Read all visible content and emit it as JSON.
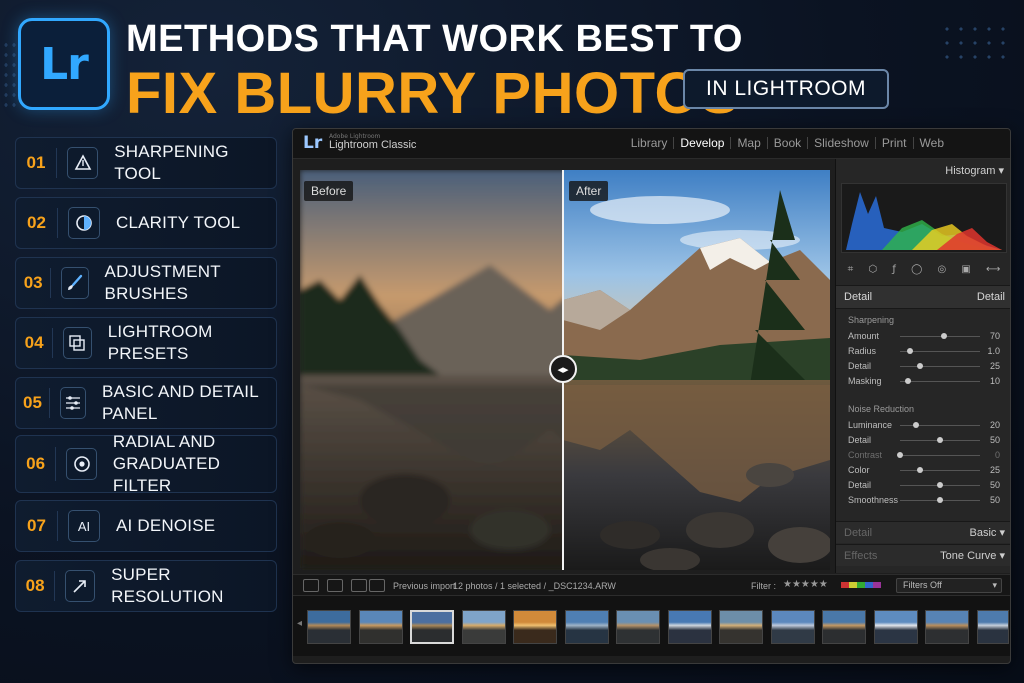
{
  "header": {
    "logo_text": "Lr",
    "title_line1": "METHODS THAT WORK BEST TO",
    "title_line2": "FIX BLURRY PHOTOS",
    "subtitle": "IN LIGHTROOM",
    "accent_color": "#f7a21b",
    "brand_color": "#31a8ff"
  },
  "methods": [
    {
      "num": "01",
      "label": "SHARPENING TOOL",
      "icon": "sharpen-triangle-icon"
    },
    {
      "num": "02",
      "label": "CLARITY TOOL",
      "icon": "half-circle-icon"
    },
    {
      "num": "03",
      "label": "ADJUSTMENT BRUSHES",
      "icon": "brush-icon"
    },
    {
      "num": "04",
      "label": "LIGHTROOM PRESETS",
      "icon": "presets-icon"
    },
    {
      "num": "05",
      "label": "BASIC AND DETAIL PANEL",
      "icon": "sliders-icon"
    },
    {
      "num": "06",
      "label": "RADIAL AND GRADUATED FILTER",
      "label_line1": "RADIAL AND",
      "label_line2": "GRADUATED FILTER",
      "icon": "radial-filter-icon"
    },
    {
      "num": "07",
      "label": "AI DENOISE",
      "icon": "ai-icon"
    },
    {
      "num": "08",
      "label": "SUPER RESOLUTION",
      "icon": "expand-arrow-icon"
    }
  ],
  "lightroom": {
    "logo": "Lr",
    "adobe": "Adobe Lightroom",
    "app_name": "Lightroom Classic",
    "modules": [
      "Library",
      "Develop",
      "Map",
      "Book",
      "Slideshow",
      "Print",
      "Web"
    ],
    "active_module": "Develop",
    "before_label": "Before",
    "after_label": "After",
    "panel": {
      "histogram_label": "Histogram",
      "detail_header_left": "Detail",
      "detail_header_right": "Detail",
      "sharpening_title": "Sharpening",
      "sharpening": [
        {
          "name": "Amount",
          "value": "70",
          "pos": 0.55
        },
        {
          "name": "Radius",
          "value": "1.0",
          "pos": 0.12
        },
        {
          "name": "Detail",
          "value": "25",
          "pos": 0.25
        },
        {
          "name": "Masking",
          "value": "10",
          "pos": 0.1
        }
      ],
      "noise_title": "Noise Reduction",
      "noise": [
        {
          "name": "Luminance",
          "value": "20",
          "pos": 0.2,
          "dim": false
        },
        {
          "name": "Detail",
          "value": "50",
          "pos": 0.5,
          "dim": false
        },
        {
          "name": "Contrast",
          "value": "0",
          "pos": 0.0,
          "dim": true
        },
        {
          "name": "Color",
          "value": "25",
          "pos": 0.25,
          "dim": false
        },
        {
          "name": "Detail",
          "value": "50",
          "pos": 0.5,
          "dim": false
        },
        {
          "name": "Smoothness",
          "value": "50",
          "pos": 0.5,
          "dim": false
        }
      ],
      "collapsed_1_left": "Detail",
      "collapsed_1_right": "Basic",
      "collapsed_2_left": "Effects",
      "collapsed_2_right": "Tone Curve"
    },
    "filmstrip": {
      "source": "Previous import",
      "info": "12 photos / 1 selected / _DSC1234.ARW",
      "filter_label": "Filter :",
      "stars": "★★★★★",
      "filters_value": "Filters Off",
      "thumbs": 14,
      "selected_index": 2
    }
  }
}
